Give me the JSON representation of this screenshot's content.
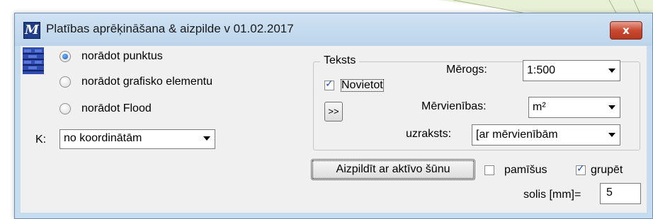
{
  "window": {
    "title": "Platības aprēķināšana & aizpilde  v 01.02.2017",
    "close_label": "x"
  },
  "radios": {
    "options": [
      "norādot punktus",
      "norādot grafisko elementu",
      "norādot Flood"
    ],
    "selected_index": 0
  },
  "k_field": {
    "label": "K:",
    "value": "no koordinātām"
  },
  "text_group": {
    "title": "Teksts",
    "place_label": "Novietot",
    "place_checked": true,
    "expand_button": ">>",
    "scale_label": "Mērogs:",
    "scale_value": "1:500",
    "units_label": "Mērvienības:",
    "units_value": "m²",
    "caption_label": "uzraksts:",
    "caption_value": "[ar mērvienībām"
  },
  "fill": {
    "button_label": "Aizpildīt ar aktīvo šūnu",
    "alternate_label": "pamīšus",
    "alternate_checked": false,
    "group_label": "grupēt",
    "group_checked": true,
    "step_label": "solis [mm]=",
    "step_value": "5"
  },
  "colors": {
    "title_bg": "#bcd4ea",
    "close_red": "#c84a31",
    "icon_blue": "#1f3d8a",
    "hatch_blue": "#3b5bbf"
  }
}
